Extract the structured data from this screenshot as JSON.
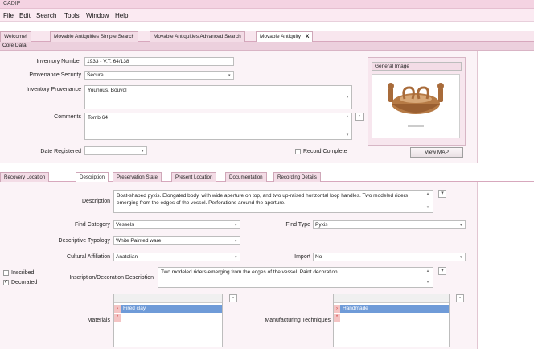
{
  "app": {
    "title": "CADIP"
  },
  "menu": [
    "File",
    "Edit",
    "Search",
    "Tools",
    "Window",
    "Help"
  ],
  "tabs": [
    {
      "label": "Welcome!"
    },
    {
      "label": "Movable Antiquities Simple Search"
    },
    {
      "label": "Movable Antiquities Advanced Search"
    },
    {
      "label": "Movable Antiquity",
      "close": "X"
    }
  ],
  "core": {
    "section_title": "Core Data",
    "inventory_number": {
      "label": "Inventory Number",
      "value": "1933 - V.T. 64/138"
    },
    "provenance_security": {
      "label": "Provenance Security",
      "value": "Secure"
    },
    "inventory_provenance": {
      "label": "Inventory Provenance",
      "value": "Younous. Bouvol"
    },
    "comments": {
      "label": "Comments",
      "value": "Tomb 64"
    },
    "date_registered": {
      "label": "Date Registered",
      "value": ""
    },
    "record_complete": {
      "label": "Record Complete",
      "checked": false
    },
    "general_image": {
      "label": "General Image"
    },
    "view_map_label": "View MAP"
  },
  "subtabs": [
    {
      "label": "Recovery Location"
    },
    {
      "label": "Description"
    },
    {
      "label": "Preservation State"
    },
    {
      "label": "Present Location"
    },
    {
      "label": "Documentation"
    },
    {
      "label": "Recording Details"
    }
  ],
  "description": {
    "description": {
      "label": "Description",
      "value": "Boat-shaped pyxis. Elongated body, with wide aperture on top, and two up-raised horizontal loop handles. Two modeled riders emerging from the edges of the vessel. Perforations around the aperture."
    },
    "find_category": {
      "label": "Find Category",
      "value": "Vessels"
    },
    "find_type": {
      "label": "Find Type",
      "value": "Pyxis"
    },
    "descriptive_typology": {
      "label": "Descriptive Typology",
      "value": "White Painted ware"
    },
    "cultural_affiliation": {
      "label": "Cultural Affiliation",
      "value": "Anatolian"
    },
    "import": {
      "label": "Import",
      "value": "No"
    },
    "inscribed": {
      "label": "Inscribed",
      "checked": false
    },
    "decorated": {
      "label": "Decorated",
      "checked": true
    },
    "inscription_description": {
      "label": "Inscription/Decoration Description",
      "value": "Two modeled riders emerging from the edges of the vessel. Paint decoration."
    },
    "materials": {
      "label": "Materials",
      "items": [
        "Fired clay"
      ]
    },
    "manufacturing_techniques": {
      "label": "Manufacturing Techniques",
      "items": [
        "Handmade"
      ]
    }
  },
  "colors": {
    "accent": "#f4d3e2",
    "selection": "#6f9bd8",
    "panel": "#fbf3f7"
  },
  "icons": {
    "dropdown": "chevron-down-icon",
    "add": "minus-icon",
    "scroll_up": "scroll-up-icon",
    "scroll_down": "scroll-down-icon"
  }
}
